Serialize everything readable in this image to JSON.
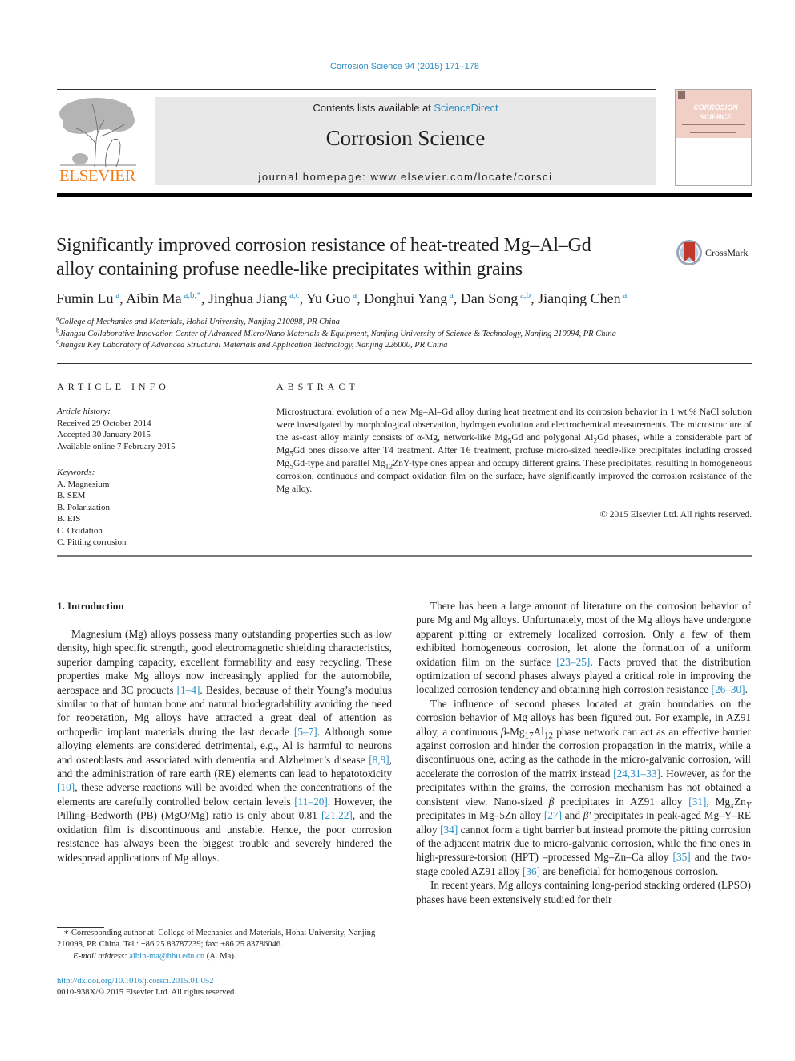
{
  "header": {
    "journal_ref": "Corrosion Science 94 (2015) 171–178",
    "contents_prefix": "Contents lists available at ",
    "contents_link": "ScienceDirect",
    "journal_title": "Corrosion Science",
    "homepage_prefix": "journal homepage: ",
    "homepage_url": "www.elsevier.com/locate/corsci",
    "publisher_logo_text": "ELSEVIER",
    "cover_title_line1": "CORROSION",
    "cover_title_line2": "SCIENCE",
    "crossmark_label": "CrossMark"
  },
  "article": {
    "title_line1": "Significantly improved corrosion resistance of heat-treated Mg–Al–Gd",
    "title_line2": "alloy containing profuse needle-like precipitates within grains",
    "authors": [
      {
        "name": "Fumin Lu",
        "aff": "a",
        "sep": ", "
      },
      {
        "name": "Aibin Ma",
        "aff": "a,b,*",
        "sep": ", "
      },
      {
        "name": "Jinghua Jiang",
        "aff": "a,c",
        "sep": ", "
      },
      {
        "name": "Yu Guo",
        "aff": "a",
        "sep": ", "
      },
      {
        "name": "Donghui Yang",
        "aff": "a",
        "sep": ", "
      },
      {
        "name": "Dan Song",
        "aff": "a,b",
        "sep": ", "
      },
      {
        "name": "Jianqing Chen",
        "aff": "a",
        "sep": ""
      }
    ],
    "affiliations": [
      {
        "key": "a",
        "text": "College of Mechanics and Materials, Hohai University, Nanjing 210098, PR China"
      },
      {
        "key": "b",
        "text": "Jiangsu Collaborative Innovation Center of Advanced Micro/Nano Materials & Equipment, Nanjing University of Science & Technology, Nanjing 210094, PR China"
      },
      {
        "key": "c",
        "text": "Jiangsu Key Laboratory of Advanced Structural Materials and Application Technology, Nanjing 226000, PR China"
      }
    ]
  },
  "article_info": {
    "heading": "ARTICLE INFO",
    "history_label": "Article history:",
    "history": [
      "Received 29 October 2014",
      "Accepted 30 January 2015",
      "Available online 7 February 2015"
    ],
    "keywords_label": "Keywords:",
    "keywords": [
      "A. Magnesium",
      "B. SEM",
      "B. Polarization",
      "B. EIS",
      "C. Oxidation",
      "C. Pitting corrosion"
    ]
  },
  "abstract": {
    "heading": "ABSTRACT",
    "s1": "Microstructural evolution of a new Mg–Al–Gd alloy during heat treatment and its corrosion behavior in 1 wt.% NaCl solution were investigated by morphological observation, hydrogen evolution and electrochemical measurements. The microstructure of the as-cast alloy mainly consists of α-Mg, network-like Mg",
    "s1_sub": "5",
    "s2": "Gd and polygonal Al",
    "s2_sub": "2",
    "s3": "Gd phases, while a considerable part of Mg",
    "s3_sub": "5",
    "s4": "Gd ones dissolve after T4 treatment. After T6 treatment, profuse micro-sized needle-like precipitates including crossed Mg",
    "s4_sub": "5",
    "s5": "Gd-type and parallel Mg",
    "s5_sub": "12",
    "s6": "ZnY-type ones appear and occupy different grains. These precipitates, resulting in homogeneous corrosion, continuous and compact oxidation film on the surface, have significantly improved the corrosion resistance of the Mg alloy.",
    "copyright": "© 2015 Elsevier Ltd. All rights reserved."
  },
  "body": {
    "section_heading": "1. Introduction",
    "left_p1": [
      {
        "t": "Magnesium (Mg) alloys possess many outstanding properties such as low density, high specific strength, good electromagnetic shielding characteristics, superior damping capacity, excellent formability and easy recycling. These properties make Mg alloys now increasingly applied for the automobile, aerospace and 3C products "
      },
      {
        "c": "[1–4]"
      },
      {
        "t": ". Besides, because of their Young’s modulus similar to that of human bone and natural biodegradability avoiding the need for reoperation, Mg alloys have attracted a great deal of attention as orthopedic implant materials during the last decade "
      },
      {
        "c": "[5–7]"
      },
      {
        "t": ". Although some alloying elements are considered detrimental, e.g., Al is harmful to neurons and osteoblasts and associated with dementia and Alzheimer’s disease "
      },
      {
        "c": "[8,9]"
      },
      {
        "t": ", and the administration of rare earth (RE) elements can lead to hepatotoxicity "
      },
      {
        "c": "[10]"
      },
      {
        "t": ", these adverse reactions will be avoided when the concentrations of the elements are carefully controlled below certain levels "
      },
      {
        "c": "[11–20]"
      },
      {
        "t": ". However, the Pilling–Bedworth (PB) (MgO/Mg) ratio is only about 0.81 "
      },
      {
        "c": "[21,22]"
      },
      {
        "t": ", and the oxidation film is discontinuous and unstable. Hence, the poor corrosion resistance has always been the biggest trouble and severely hindered the widespread applications of Mg alloys."
      }
    ],
    "right_p1": [
      {
        "t": "There has been a large amount of literature on the corrosion behavior of pure Mg and Mg alloys. Unfortunately, most of the Mg alloys have undergone apparent pitting or extremely localized corrosion. Only a few of them exhibited homogeneous corrosion, let alone the formation of a uniform oxidation film on the surface "
      },
      {
        "c": "[23–25]"
      },
      {
        "t": ". Facts proved that the distribution optimization of second phases always played a critical role in improving the localized corrosion tendency and obtaining high corrosion resistance "
      },
      {
        "c": "[26–30]"
      },
      {
        "t": "."
      }
    ],
    "right_p2": [
      {
        "t": "The influence of second phases located at grain boundaries on the corrosion behavior of Mg alloys has been figured out. For example, in AZ91 alloy, a continuous "
      },
      {
        "i": "β"
      },
      {
        "t": "-Mg"
      },
      {
        "s": "17"
      },
      {
        "t": "Al"
      },
      {
        "s": "12"
      },
      {
        "t": " phase network can act as an effective barrier against corrosion and hinder the corrosion propagation in the matrix, while a discontinuous one, acting as the cathode in the micro-galvanic corrosion, will accelerate the corrosion of the matrix instead "
      },
      {
        "c": "[24,31–33]"
      },
      {
        "t": ". However, as for the precipitates within the grains, the corrosion mechanism has not obtained a consistent view. Nano-sized "
      },
      {
        "i": "β"
      },
      {
        "t": " precipitates in AZ91 alloy "
      },
      {
        "c": "[31]"
      },
      {
        "t": ", Mg"
      },
      {
        "si": "x"
      },
      {
        "t": "Zn"
      },
      {
        "si": "Y"
      },
      {
        "t": " precipitates in Mg–5Zn alloy "
      },
      {
        "c": "[27]"
      },
      {
        "t": " and "
      },
      {
        "i": "β′"
      },
      {
        "t": " precipitates in peak-aged Mg–Y–RE alloy "
      },
      {
        "c": "[34]"
      },
      {
        "t": " cannot form a tight barrier but instead promote the pitting corrosion of the adjacent matrix due to micro-galvanic corrosion, while the fine ones in high-pressure-torsion (HPT) –processed Mg–Zn–Ca alloy "
      },
      {
        "c": "[35]"
      },
      {
        "t": " and the two-stage cooled AZ91 alloy "
      },
      {
        "c": "[36]"
      },
      {
        "t": " are beneficial for homogenous corrosion."
      }
    ],
    "right_p3": [
      {
        "t": "In recent years, Mg alloys containing long-period stacking ordered (LPSO) phases have been extensively studied for their"
      }
    ]
  },
  "footnotes": {
    "corresponding": "∗ Corresponding author at: College of Mechanics and Materials, Hohai University, Nanjing 210098, PR China. Tel.: +86 25 83787239; fax: +86 25 83786046.",
    "email_label": "E-mail address: ",
    "email": "aibin-ma@hhu.edu.cn",
    "email_suffix": " (A. Ma).",
    "doi": "http://dx.doi.org/10.1016/j.corsci.2015.01.052",
    "issn": "0010-938X/© 2015 Elsevier Ltd. All rights reserved."
  },
  "colors": {
    "link": "#2a8dc5",
    "elsevier_orange": "#f07f1d",
    "masthead_bg": "#e8e8e8",
    "cover_pink": "#f1cec6"
  }
}
